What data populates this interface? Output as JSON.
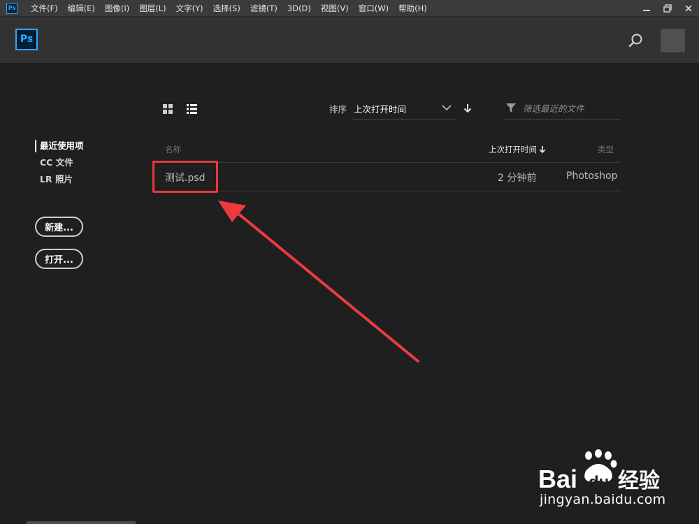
{
  "menubar": {
    "app_icon": "Ps",
    "items": [
      "文件(F)",
      "编辑(E)",
      "图像(I)",
      "图层(L)",
      "文字(Y)",
      "选择(S)",
      "滤镜(T)",
      "3D(D)",
      "视图(V)",
      "窗口(W)",
      "帮助(H)"
    ],
    "window_controls": {
      "minimize": "minimize-icon",
      "restore": "restore-icon",
      "close": "close-icon"
    }
  },
  "header": {
    "logo": "Ps",
    "icons": [
      "search-icon",
      "avatar"
    ]
  },
  "sidebar": {
    "items": [
      {
        "label": "最近使用项",
        "active": true
      },
      {
        "label": "CC 文件",
        "active": false
      },
      {
        "label": "LR 照片",
        "active": false
      }
    ],
    "new_button": "新建...",
    "open_button": "打开..."
  },
  "toolbar": {
    "sort_label": "排序",
    "sort_value": "上次打开时间",
    "filter_placeholder": "筛选最近的文件"
  },
  "table": {
    "headers": {
      "name": "名称",
      "time": "上次打开时间",
      "type": "类型"
    },
    "rows": [
      {
        "name": "测试.psd",
        "time": "2 分钟前",
        "type": "Photoshop"
      }
    ]
  },
  "watermark": {
    "brand": "Bai",
    "brand_end": "du",
    "suffix": "经验",
    "url": "jingyan.baidu.com"
  },
  "colors": {
    "accent": "#31a8ff",
    "annotation": "#e8383d",
    "background": "#1f1f1f",
    "header": "#323232",
    "menubar": "#3b3b3b"
  }
}
